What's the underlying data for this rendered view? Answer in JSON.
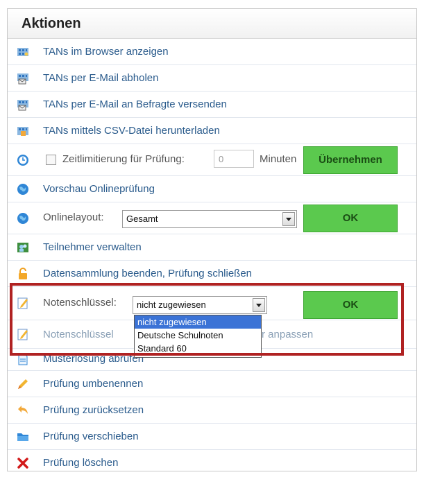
{
  "panel": {
    "title": "Aktionen"
  },
  "rows": [
    {
      "label": "TANs im Browser anzeigen",
      "icon": "tan-grid-icon"
    },
    {
      "label": "TANs per E-Mail abholen",
      "icon": "tan-mail-icon"
    },
    {
      "label": "TANs per E-Mail an Befragte versenden",
      "icon": "tan-mail-icon"
    },
    {
      "label": "TANs mittels CSV-Datei herunterladen",
      "icon": "tan-csv-icon"
    },
    {
      "label": "Zeitlimitierung für Prüfung:",
      "icon": "clock-icon"
    },
    {
      "label": "Vorschau Onlineprüfung",
      "icon": "globe-icon"
    },
    {
      "label": "Onlinelayout:",
      "icon": "globe-icon"
    },
    {
      "label": "Teilnehmer verwalten",
      "icon": "participants-icon"
    },
    {
      "label": "Datensammlung beenden, Prüfung schließen",
      "icon": "lock-icon"
    },
    {
      "label": "Notenschlüssel:",
      "icon": "edit-icon"
    },
    {
      "label": "Notenschlüssel",
      "label_tail": "r anpassen",
      "icon": "edit-icon"
    },
    {
      "label": "Musterlösung abrufen",
      "icon": "document-icon"
    },
    {
      "label": "Prüfung umbenennen",
      "icon": "pencil-icon"
    },
    {
      "label": "Prüfung zurücksetzen",
      "icon": "undo-icon"
    },
    {
      "label": "Prüfung verschieben",
      "icon": "folder-icon"
    },
    {
      "label": "Prüfung löschen",
      "icon": "delete-x-icon"
    }
  ],
  "time_limit": {
    "input_value": "0",
    "unit": "Minuten",
    "button": "Übernehmen"
  },
  "layout": {
    "selected": "Gesamt",
    "button": "OK"
  },
  "grading": {
    "selected": "nicht zugewiesen",
    "button": "OK",
    "options": [
      "nicht zugewiesen",
      "Deutsche Schulnoten",
      "Standard 60"
    ]
  },
  "colors": {
    "link": "#2a5b8c",
    "button_green": "#5bc94e",
    "highlight_red": "#b02222",
    "selected_option": "#3b73d6"
  }
}
